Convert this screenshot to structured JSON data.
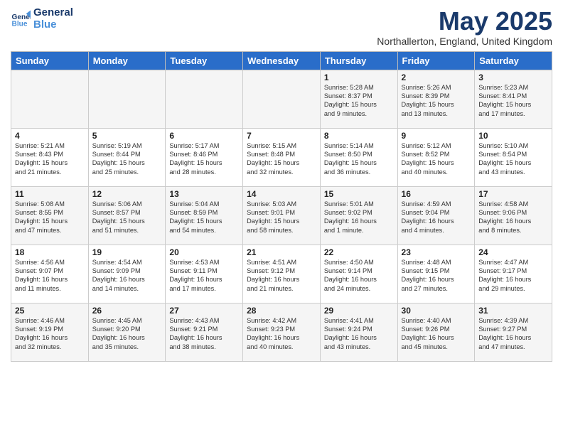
{
  "header": {
    "logo_line1": "General",
    "logo_line2": "Blue",
    "month_title": "May 2025",
    "location": "Northallerton, England, United Kingdom"
  },
  "weekdays": [
    "Sunday",
    "Monday",
    "Tuesday",
    "Wednesday",
    "Thursday",
    "Friday",
    "Saturday"
  ],
  "weeks": [
    [
      {
        "day": "",
        "info": ""
      },
      {
        "day": "",
        "info": ""
      },
      {
        "day": "",
        "info": ""
      },
      {
        "day": "",
        "info": ""
      },
      {
        "day": "1",
        "info": "Sunrise: 5:28 AM\nSunset: 8:37 PM\nDaylight: 15 hours\nand 9 minutes."
      },
      {
        "day": "2",
        "info": "Sunrise: 5:26 AM\nSunset: 8:39 PM\nDaylight: 15 hours\nand 13 minutes."
      },
      {
        "day": "3",
        "info": "Sunrise: 5:23 AM\nSunset: 8:41 PM\nDaylight: 15 hours\nand 17 minutes."
      }
    ],
    [
      {
        "day": "4",
        "info": "Sunrise: 5:21 AM\nSunset: 8:43 PM\nDaylight: 15 hours\nand 21 minutes."
      },
      {
        "day": "5",
        "info": "Sunrise: 5:19 AM\nSunset: 8:44 PM\nDaylight: 15 hours\nand 25 minutes."
      },
      {
        "day": "6",
        "info": "Sunrise: 5:17 AM\nSunset: 8:46 PM\nDaylight: 15 hours\nand 28 minutes."
      },
      {
        "day": "7",
        "info": "Sunrise: 5:15 AM\nSunset: 8:48 PM\nDaylight: 15 hours\nand 32 minutes."
      },
      {
        "day": "8",
        "info": "Sunrise: 5:14 AM\nSunset: 8:50 PM\nDaylight: 15 hours\nand 36 minutes."
      },
      {
        "day": "9",
        "info": "Sunrise: 5:12 AM\nSunset: 8:52 PM\nDaylight: 15 hours\nand 40 minutes."
      },
      {
        "day": "10",
        "info": "Sunrise: 5:10 AM\nSunset: 8:54 PM\nDaylight: 15 hours\nand 43 minutes."
      }
    ],
    [
      {
        "day": "11",
        "info": "Sunrise: 5:08 AM\nSunset: 8:55 PM\nDaylight: 15 hours\nand 47 minutes."
      },
      {
        "day": "12",
        "info": "Sunrise: 5:06 AM\nSunset: 8:57 PM\nDaylight: 15 hours\nand 51 minutes."
      },
      {
        "day": "13",
        "info": "Sunrise: 5:04 AM\nSunset: 8:59 PM\nDaylight: 15 hours\nand 54 minutes."
      },
      {
        "day": "14",
        "info": "Sunrise: 5:03 AM\nSunset: 9:01 PM\nDaylight: 15 hours\nand 58 minutes."
      },
      {
        "day": "15",
        "info": "Sunrise: 5:01 AM\nSunset: 9:02 PM\nDaylight: 16 hours\nand 1 minute."
      },
      {
        "day": "16",
        "info": "Sunrise: 4:59 AM\nSunset: 9:04 PM\nDaylight: 16 hours\nand 4 minutes."
      },
      {
        "day": "17",
        "info": "Sunrise: 4:58 AM\nSunset: 9:06 PM\nDaylight: 16 hours\nand 8 minutes."
      }
    ],
    [
      {
        "day": "18",
        "info": "Sunrise: 4:56 AM\nSunset: 9:07 PM\nDaylight: 16 hours\nand 11 minutes."
      },
      {
        "day": "19",
        "info": "Sunrise: 4:54 AM\nSunset: 9:09 PM\nDaylight: 16 hours\nand 14 minutes."
      },
      {
        "day": "20",
        "info": "Sunrise: 4:53 AM\nSunset: 9:11 PM\nDaylight: 16 hours\nand 17 minutes."
      },
      {
        "day": "21",
        "info": "Sunrise: 4:51 AM\nSunset: 9:12 PM\nDaylight: 16 hours\nand 21 minutes."
      },
      {
        "day": "22",
        "info": "Sunrise: 4:50 AM\nSunset: 9:14 PM\nDaylight: 16 hours\nand 24 minutes."
      },
      {
        "day": "23",
        "info": "Sunrise: 4:48 AM\nSunset: 9:15 PM\nDaylight: 16 hours\nand 27 minutes."
      },
      {
        "day": "24",
        "info": "Sunrise: 4:47 AM\nSunset: 9:17 PM\nDaylight: 16 hours\nand 29 minutes."
      }
    ],
    [
      {
        "day": "25",
        "info": "Sunrise: 4:46 AM\nSunset: 9:19 PM\nDaylight: 16 hours\nand 32 minutes."
      },
      {
        "day": "26",
        "info": "Sunrise: 4:45 AM\nSunset: 9:20 PM\nDaylight: 16 hours\nand 35 minutes."
      },
      {
        "day": "27",
        "info": "Sunrise: 4:43 AM\nSunset: 9:21 PM\nDaylight: 16 hours\nand 38 minutes."
      },
      {
        "day": "28",
        "info": "Sunrise: 4:42 AM\nSunset: 9:23 PM\nDaylight: 16 hours\nand 40 minutes."
      },
      {
        "day": "29",
        "info": "Sunrise: 4:41 AM\nSunset: 9:24 PM\nDaylight: 16 hours\nand 43 minutes."
      },
      {
        "day": "30",
        "info": "Sunrise: 4:40 AM\nSunset: 9:26 PM\nDaylight: 16 hours\nand 45 minutes."
      },
      {
        "day": "31",
        "info": "Sunrise: 4:39 AM\nSunset: 9:27 PM\nDaylight: 16 hours\nand 47 minutes."
      }
    ]
  ]
}
